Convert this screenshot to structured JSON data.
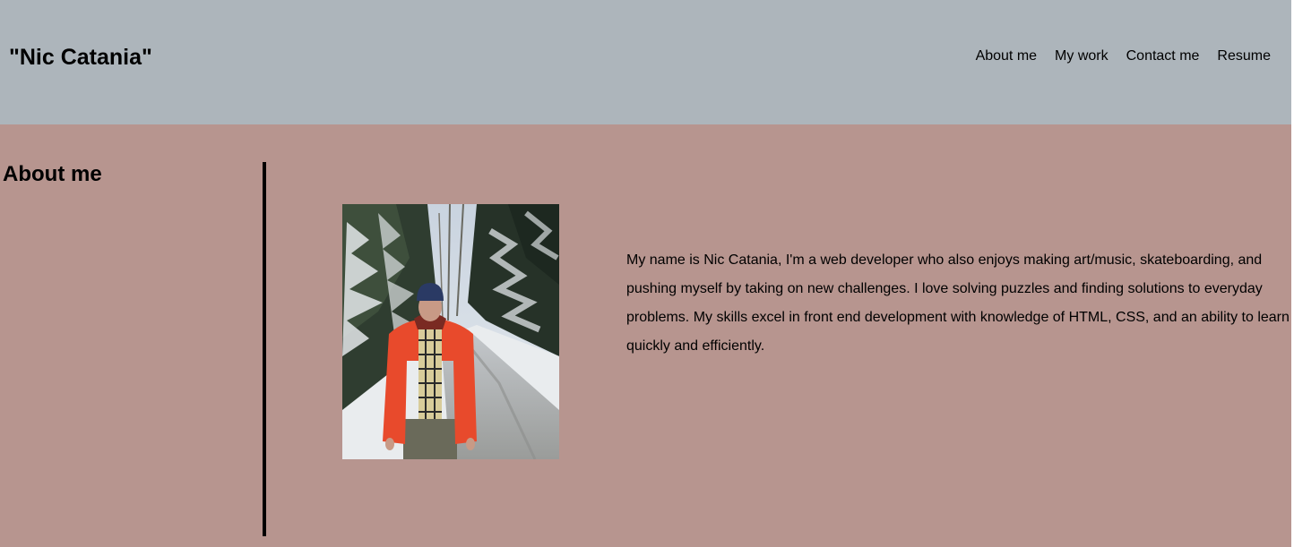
{
  "header": {
    "site_title": "\"Nic Catania\"",
    "nav": {
      "about": "About me",
      "work": "My work",
      "contact": "Contact me",
      "resume": "Resume"
    }
  },
  "about": {
    "heading": "About me",
    "bio": "My name is Nic Catania, I'm a web developer who also enjoys making art/music, skateboarding, and pushing myself by taking on new challenges. I love solving puzzles and finding solutions to everyday problems. My skills excel in front end development with knowledge of HTML, CSS, and an ability to learn quickly and efficiently."
  },
  "colors": {
    "header_bg": "#adb5bb",
    "main_bg": "#b7958f",
    "text": "#000000"
  }
}
